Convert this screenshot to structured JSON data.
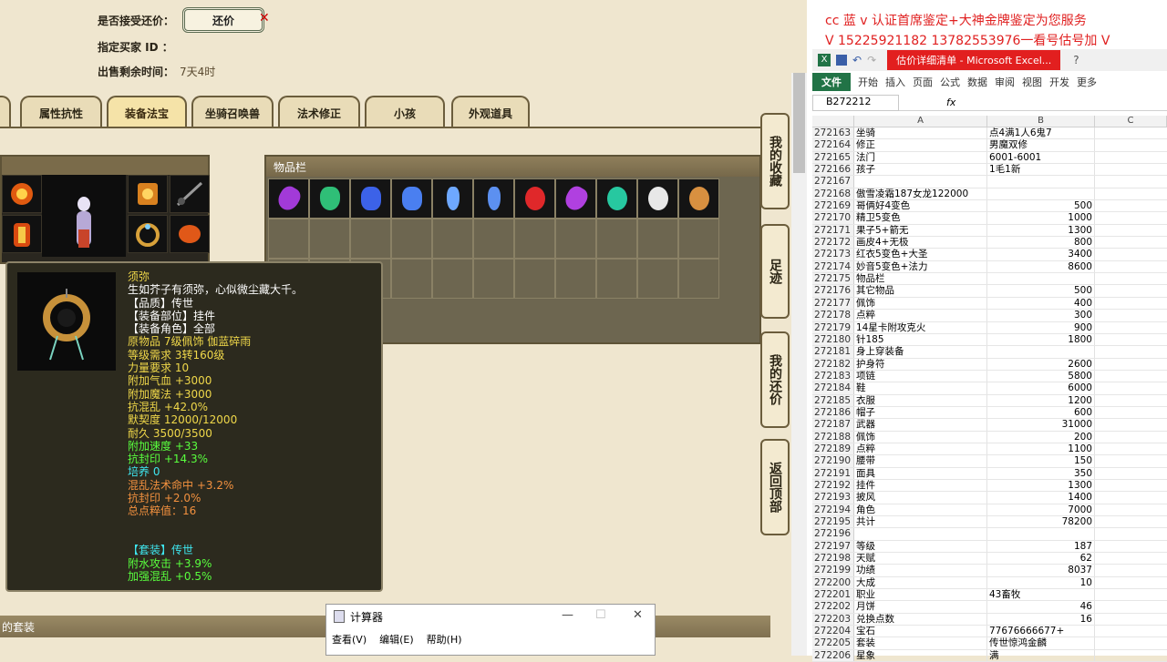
{
  "game": {
    "bargain_label": "是否接受还价：",
    "bargain_button": "还价",
    "buyer_label": "指定买家 ID ：",
    "remaining_label": "出售剩余时间：",
    "remaining_value": "7天4时",
    "tabs": [
      "属性抗性",
      "装备法宝",
      "坐骑召唤兽",
      "法术修正",
      "小孩",
      "外观道具"
    ],
    "inventory_title": "物品栏",
    "side_nav": [
      "我的收藏",
      "足迹",
      "我的还价",
      "返回顶部"
    ],
    "set_bar": "的套装",
    "tooltip": {
      "lines": [
        {
          "t": "须弥",
          "c": "yellow"
        },
        {
          "t": "生如芥子有须弥，心似微尘藏大千。",
          "c": "white"
        },
        {
          "t": "【品质】传世",
          "c": "white"
        },
        {
          "t": "【装备部位】挂件",
          "c": "white"
        },
        {
          "t": "【装备角色】全部",
          "c": "white"
        },
        {
          "t": "原物品 7级佩饰 伽蓝碎雨",
          "c": "yellow"
        },
        {
          "t": "等级需求 3转160级",
          "c": "yellow"
        },
        {
          "t": "力量要求 10",
          "c": "yellow"
        },
        {
          "t": "附加气血 +3000",
          "c": "yellow"
        },
        {
          "t": "附加魔法 +3000",
          "c": "yellow"
        },
        {
          "t": "抗混乱 +42.0%",
          "c": "yellow"
        },
        {
          "t": "默契度 12000/12000",
          "c": "yellow"
        },
        {
          "t": "耐久 3500/3500",
          "c": "yellow"
        },
        {
          "t": "附加速度 +33",
          "c": "green"
        },
        {
          "t": "抗封印 +14.3%",
          "c": "green"
        },
        {
          "t": "培养 0",
          "c": "cyan"
        },
        {
          "t": "混乱法术命中 +3.2%",
          "c": "orange"
        },
        {
          "t": "抗封印 +2.0%",
          "c": "orange"
        },
        {
          "t": "总点粹值：16",
          "c": "orange"
        },
        {
          "t": "",
          "c": "white"
        },
        {
          "t": "",
          "c": "white"
        },
        {
          "t": "【套装】传世",
          "c": "cyan"
        },
        {
          "t": "附水攻击 +3.9%",
          "c": "green"
        },
        {
          "t": "加强混乱 +0.5%",
          "c": "green"
        }
      ]
    }
  },
  "calculator": {
    "title": "计算器",
    "menu": [
      "查看(V)",
      "编辑(E)",
      "帮助(H)"
    ]
  },
  "overlay": {
    "line1": "cc 蓝 v 认证首席鉴定+大神金牌鉴定为您服务",
    "line2": "V 15225921182    13782553976一看号估号加 V"
  },
  "excel": {
    "title": "估价详细清单 - Microsoft Excel...",
    "ribbon": [
      "文件",
      "开始",
      "插入",
      "页面",
      "公式",
      "数据",
      "审阅",
      "视图",
      "开发",
      "更多"
    ],
    "name_box": "B272212",
    "fx": "fx",
    "columns": [
      "A",
      "B",
      "C"
    ],
    "rows": [
      [
        "272163",
        "坐骑",
        "点4满1人6鬼7"
      ],
      [
        "272164",
        "修正",
        "男魔双修"
      ],
      [
        "272165",
        "法门",
        "6001-6001"
      ],
      [
        "272166",
        "孩子",
        "1毛1新"
      ],
      [
        "272167",
        "",
        ""
      ],
      [
        "272168",
        "傲雪凌霜187女龙122000",
        ""
      ],
      [
        "272169",
        "哥俩好4变色",
        "500"
      ],
      [
        "272170",
        "精卫5变色",
        "1000"
      ],
      [
        "272171",
        "果子5+箭无",
        "1300"
      ],
      [
        "272172",
        "画皮4+无极",
        "800"
      ],
      [
        "272173",
        "红衣5变色+大圣",
        "3400"
      ],
      [
        "272174",
        "妙音5变色+法力",
        "8600"
      ],
      [
        "272175",
        "物品栏",
        ""
      ],
      [
        "272176",
        "其它物品",
        "500"
      ],
      [
        "272177",
        "佩饰",
        "400"
      ],
      [
        "272178",
        "点粹",
        "300"
      ],
      [
        "272179",
        "14星卡附攻克火",
        "900"
      ],
      [
        "272180",
        "针185",
        "1800"
      ],
      [
        "272181",
        "身上穿装备",
        ""
      ],
      [
        "272182",
        "护身符",
        "2600"
      ],
      [
        "272183",
        "项链",
        "5800"
      ],
      [
        "272184",
        "鞋",
        "6000"
      ],
      [
        "272185",
        "衣服",
        "1200"
      ],
      [
        "272186",
        "帽子",
        "600"
      ],
      [
        "272187",
        "武器",
        "31000"
      ],
      [
        "272188",
        "佩饰",
        "200"
      ],
      [
        "272189",
        "点粹",
        "1100"
      ],
      [
        "272190",
        "腰带",
        "150"
      ],
      [
        "272191",
        "面具",
        "350"
      ],
      [
        "272192",
        "挂件",
        "1300"
      ],
      [
        "272193",
        "披风",
        "1400"
      ],
      [
        "272194",
        "角色",
        "7000"
      ],
      [
        "272195",
        "共计",
        "78200"
      ],
      [
        "272196",
        "",
        ""
      ],
      [
        "272197",
        "等级",
        "187"
      ],
      [
        "272198",
        "天赋",
        "62"
      ],
      [
        "272199",
        "功绩",
        "8037"
      ],
      [
        "272200",
        "大成",
        "10"
      ],
      [
        "272201",
        "职业",
        "43畜牧"
      ],
      [
        "272202",
        "月饼",
        "46"
      ],
      [
        "272203",
        "兑换点数",
        "16"
      ],
      [
        "272204",
        "宝石",
        "77676666677+"
      ],
      [
        "272205",
        "套装",
        "传世惊鸿金麟"
      ],
      [
        "272206",
        "星象",
        "满"
      ]
    ]
  },
  "colors": {
    "excel_green": "#217346",
    "title_red": "#e21f1f",
    "overlay_red": "#e02020"
  }
}
